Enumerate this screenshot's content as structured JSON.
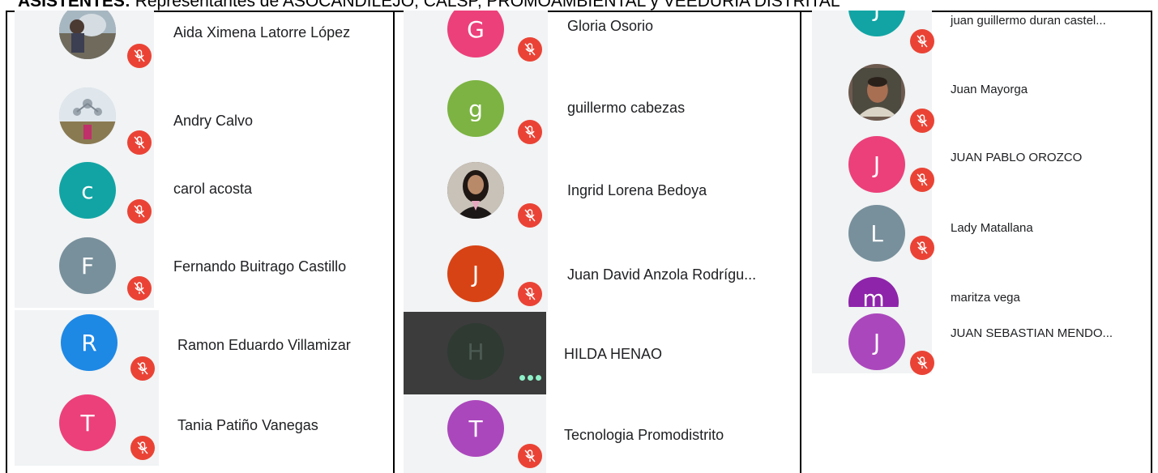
{
  "header": {
    "label": "ASISTENTES:",
    "text": " Representantes de ASOCANDILEJO, CALSP, PROMOAMBIENTAL y VEEDURIA DISTRITAL"
  },
  "columns": [
    {
      "participants": [
        {
          "name": "Aida Ximena Latorre López",
          "initial": "",
          "avatar_color": "#7b8f9c",
          "photo": true
        },
        {
          "name": "Andry Calvo",
          "initial": "",
          "avatar_color": "#c9d3dc",
          "photo": true
        },
        {
          "name": "carol acosta",
          "initial": "c",
          "avatar_color": "#12a4a4"
        },
        {
          "name": "Fernando Buitrago Castillo",
          "initial": "F",
          "avatar_color": "#78909c"
        },
        {
          "name": "Ramon Eduardo Villamizar",
          "initial": "R",
          "avatar_color": "#1e88e5"
        },
        {
          "name": "Tania Patiño Vanegas",
          "initial": "T",
          "avatar_color": "#ec407a"
        }
      ]
    },
    {
      "participants": [
        {
          "name": "Gloria Osorio",
          "initial": "G",
          "avatar_color": "#ec407a"
        },
        {
          "name": "guillermo cabezas",
          "initial": "g",
          "avatar_color": "#7cb342"
        },
        {
          "name": "Ingrid Lorena Bedoya",
          "initial": "",
          "avatar_color": "#5d4a44",
          "photo": true
        },
        {
          "name": "Juan David Anzola Rodrígu...",
          "initial": "J",
          "avatar_color": "#d84315"
        },
        {
          "name": "HILDA HENAO",
          "initial": "H",
          "avatar_color": "#2f3a33",
          "speaking": true
        },
        {
          "name": "Tecnologia Promodistrito",
          "initial": "T",
          "avatar_color": "#ab47bc"
        }
      ]
    },
    {
      "participants": [
        {
          "name": "juan guillermo duran castel...",
          "initial": "J",
          "avatar_color": "#12a4a4"
        },
        {
          "name": "Juan Mayorga",
          "initial": "",
          "avatar_color": "#6d5a4e",
          "photo": true
        },
        {
          "name": "JUAN PABLO OROZCO",
          "initial": "J",
          "avatar_color": "#ec407a"
        },
        {
          "name": "Lady Matallana",
          "initial": "L",
          "avatar_color": "#78909c"
        },
        {
          "name": "maritza vega",
          "initial": "m",
          "avatar_color": "#8e24aa"
        },
        {
          "name": "JUAN SEBASTIAN MENDO...",
          "initial": "J",
          "avatar_color": "#ab47bc"
        }
      ]
    }
  ]
}
